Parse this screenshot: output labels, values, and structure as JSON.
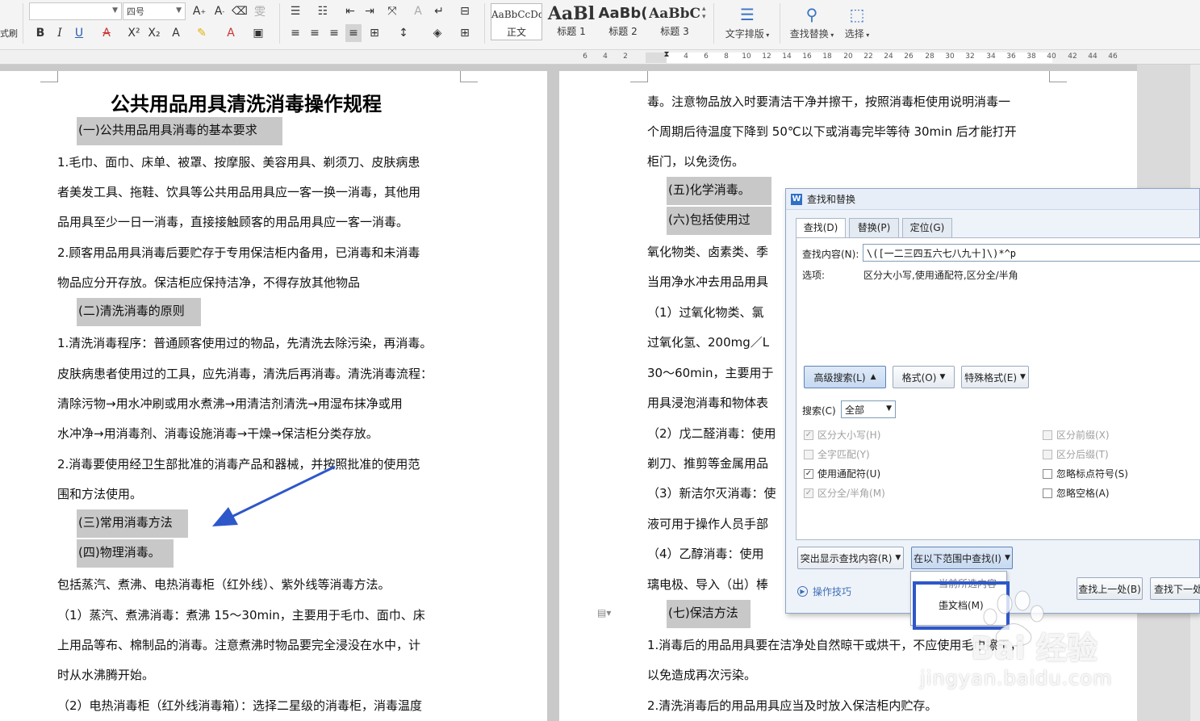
{
  "toolbar": {
    "left_cut_label": "式刷",
    "font_size": "四号",
    "styles": [
      {
        "sample": "AaBbCcDd",
        "name": "正文"
      },
      {
        "sample": "AaBl",
        "name": "标题 1"
      },
      {
        "sample": "AaBb(",
        "name": "标题 2"
      },
      {
        "sample": "AaBbC",
        "name": "标题 3"
      }
    ],
    "text_layout": "文字排版",
    "find_replace": "查找替换",
    "select": "选择"
  },
  "ruler": {
    "ticks": [
      "6",
      "4",
      "2",
      "2",
      "4",
      "6",
      "8",
      "10",
      "12",
      "14",
      "16",
      "18",
      "20",
      "22",
      "24",
      "26",
      "28",
      "30",
      "32",
      "34",
      "36",
      "38",
      "40",
      "42",
      "44",
      "46"
    ]
  },
  "left_page": {
    "title": "公共用品用具清洗消毒操作规程",
    "h1": "(一)公共用品用具消毒的基本要求",
    "p1a": "1.毛巾、面巾、床单、被罩、按摩服、美容用具、剃须刀、皮肤病患",
    "p1b": "者美发工具、拖鞋、饮具等公共用品用具应一客一换一消毒，其他用",
    "p1c": "品用具至少一日一消毒，直接接触顾客的用品用具应一客一消毒。",
    "p2a": "2.顾客用品用具消毒后要贮存于专用保洁柜内备用，已消毒和未消毒",
    "p2b": "物品应分开存放。保洁柜应保持洁净，不得存放其他物品",
    "h2": "(二)清洗消毒的原则",
    "p3a": "1.清洗消毒程序：普通顾客使用过的物品，先清洗去除污染，再消毒。",
    "p3b": "皮肤病患者使用过的工具，应先消毒，清洗后再消毒。清洗消毒流程：",
    "p3c": "清除污物→用水冲刷或用水煮沸→用清洁剂清洗→用湿布抹净或用",
    "p3d": "水冲净→用消毒剂、消毒设施消毒→干燥→保洁柜分类存放。",
    "p4a": "2.消毒要使用经卫生部批准的消毒产品和器械，并按照批准的使用范",
    "p4b": "围和方法使用。",
    "h3": "(三)常用消毒方法",
    "h4": "(四)物理消毒。",
    "p5": "包括蒸汽、煮沸、电热消毒柜（红外线）、紫外线等消毒方法。",
    "p6a": "（1）蒸汽、煮沸消毒：煮沸 15～30min，主要用于毛巾、面巾、床",
    "p6b": "上用品等布、棉制品的消毒。注意煮沸时物品要完全浸没在水中，计",
    "p6c": "时从水沸腾开始。",
    "p7": "（2）电热消毒柜（红外线消毒箱）：选择二星级的消毒柜，消毒温度"
  },
  "right_page": {
    "l1": "毒。注意物品放入时要清洁干净并擦干，按照消毒柜使用说明消毒一",
    "l2": "个周期后待温度下降到 50℃以下或消毒完毕等待 30min 后才能打开",
    "l3": "柜门，以免烫伤。",
    "h5": "(五)化学消毒。",
    "h6": "(六)包括使用过",
    "l4": "氧化物类、卤素类、季",
    "l5": "当用净水冲去用品用具",
    "l6": "（1）过氧化物类、氯",
    "l7": "过氧化氢、200mg／L",
    "l8": "30～60min，主要用于",
    "l9": "用具浸泡消毒和物体表",
    "l10": "（2）戊二醛消毒：使用",
    "l11": "剃刀、推剪等金属用品",
    "l12": "（3）新洁尔灭消毒：使",
    "l13": "液可用于操作人员手部",
    "l14": "（4）乙醇消毒：使用",
    "l15": "璃电极、导入（出）棒",
    "h7": "(七)保洁方法",
    "l16": "1.消毒后的用品用具要在洁净处自然晾干或烘干，不应使用毛巾擦干，",
    "l17": "以免造成再次污染。",
    "l18": "2.清洗消毒后的用品用具应当及时放入保洁柜内贮存。"
  },
  "dialog": {
    "title": "查找和替换",
    "icon": "W",
    "tabs": [
      "查找(D)",
      "替换(P)",
      "定位(G)"
    ],
    "find_label": "查找内容(N):",
    "find_value": "\\([一二三四五六七八九十]\\)*^p",
    "options_label": "选项:",
    "options_value": "区分大小写,使用通配符,区分全/半角",
    "advanced_btn": "高级搜索(L)",
    "format_btn": "格式(O)",
    "special_btn": "特殊格式(E)",
    "search_label": "搜索(C)",
    "search_value": "全部",
    "checks_left": [
      {
        "label": "区分大小写(H)",
        "checked": true,
        "disabled": true
      },
      {
        "label": "全字匹配(Y)",
        "checked": false,
        "disabled": true
      },
      {
        "label": "使用通配符(U)",
        "checked": true,
        "disabled": false
      },
      {
        "label": "区分全/半角(M)",
        "checked": true,
        "disabled": true
      }
    ],
    "checks_right": [
      {
        "label": "区分前缀(X)",
        "checked": false,
        "disabled": true
      },
      {
        "label": "区分后缀(T)",
        "checked": false,
        "disabled": true
      },
      {
        "label": "忽略标点符号(S)",
        "checked": false,
        "disabled": false
      },
      {
        "label": "忽略空格(A)",
        "checked": false,
        "disabled": false
      }
    ],
    "highlight_btn": "突出显示查找内容(R)",
    "find_in_btn": "在以下范围中查找(I)",
    "tips": "操作技巧",
    "prev_btn": "查找上一处(B)",
    "next_btn": "查找下一处",
    "dropdown_items": [
      "当前所选内容(S)",
      "主文档(M)"
    ]
  },
  "watermark": {
    "text": "Bai 经验",
    "url": "jingyan.baidu.com"
  },
  "colors": {
    "heading_highlight": "#c8c8c8",
    "annotation": "#2e57c9",
    "accent": "#3a75c4"
  }
}
